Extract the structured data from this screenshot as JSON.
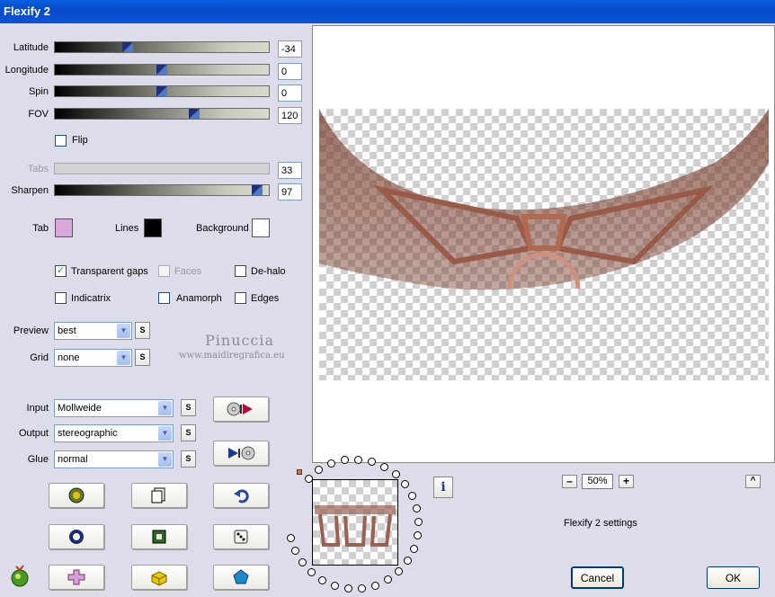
{
  "window": {
    "title": "Flexify 2"
  },
  "sliders": [
    {
      "label": "Latitude",
      "value": "-34",
      "level": 0.33,
      "disabled": false
    },
    {
      "label": "Longitude",
      "value": "0",
      "level": 0.5,
      "disabled": false
    },
    {
      "label": "Spin",
      "value": "0",
      "level": 0.5,
      "disabled": false
    },
    {
      "label": "FOV",
      "value": "120",
      "level": 0.66,
      "disabled": false
    },
    {
      "label": "Tabs",
      "value": "33",
      "level": 0.33,
      "disabled": true
    },
    {
      "label": "Sharpen",
      "value": "97",
      "level": 0.97,
      "disabled": false
    }
  ],
  "flip": {
    "label": "Flip",
    "checked": false
  },
  "colors": {
    "tab": {
      "label": "Tab",
      "color": "#d8a8d8"
    },
    "lines": {
      "label": "Lines",
      "color": "#000000"
    },
    "background": {
      "label": "Background",
      "color": "#ffffff"
    }
  },
  "options": {
    "transparent_gaps": {
      "label": "Transparent gaps",
      "checked": true
    },
    "faces": {
      "label": "Faces",
      "checked": false
    },
    "de_halo": {
      "label": "De-halo",
      "checked": false
    },
    "indicatrix": {
      "label": "Indicatrix",
      "checked": false
    },
    "anamorph": {
      "label": "Anamorph",
      "checked": false
    },
    "edges": {
      "label": "Edges",
      "checked": false
    }
  },
  "preview_select": {
    "label": "Preview",
    "value": "best"
  },
  "grid_select": {
    "label": "Grid",
    "value": "none"
  },
  "watermark": {
    "name": "Pinuccia",
    "url": "www.maidiregrafica.eu"
  },
  "input_select": {
    "label": "Input",
    "value": "Mollweide"
  },
  "output_select": {
    "label": "Output",
    "value": "stereographic"
  },
  "glue_select": {
    "label": "Glue",
    "value": "normal"
  },
  "s_label": "S",
  "zoom": {
    "minus": "–",
    "value": "50%",
    "plus": "+"
  },
  "caret": "^",
  "status_text": "Flexify 2 settings",
  "buttons": {
    "cancel": "Cancel",
    "ok": "OK"
  },
  "icons": {
    "row1": [
      "randomize-icon",
      "copy-icon",
      "undo-icon"
    ],
    "row2": [
      "circle-icon",
      "square-icon",
      "dice-icon"
    ],
    "row3": [
      "plus-icon",
      "cube-icon",
      "pentagon-icon"
    ]
  }
}
